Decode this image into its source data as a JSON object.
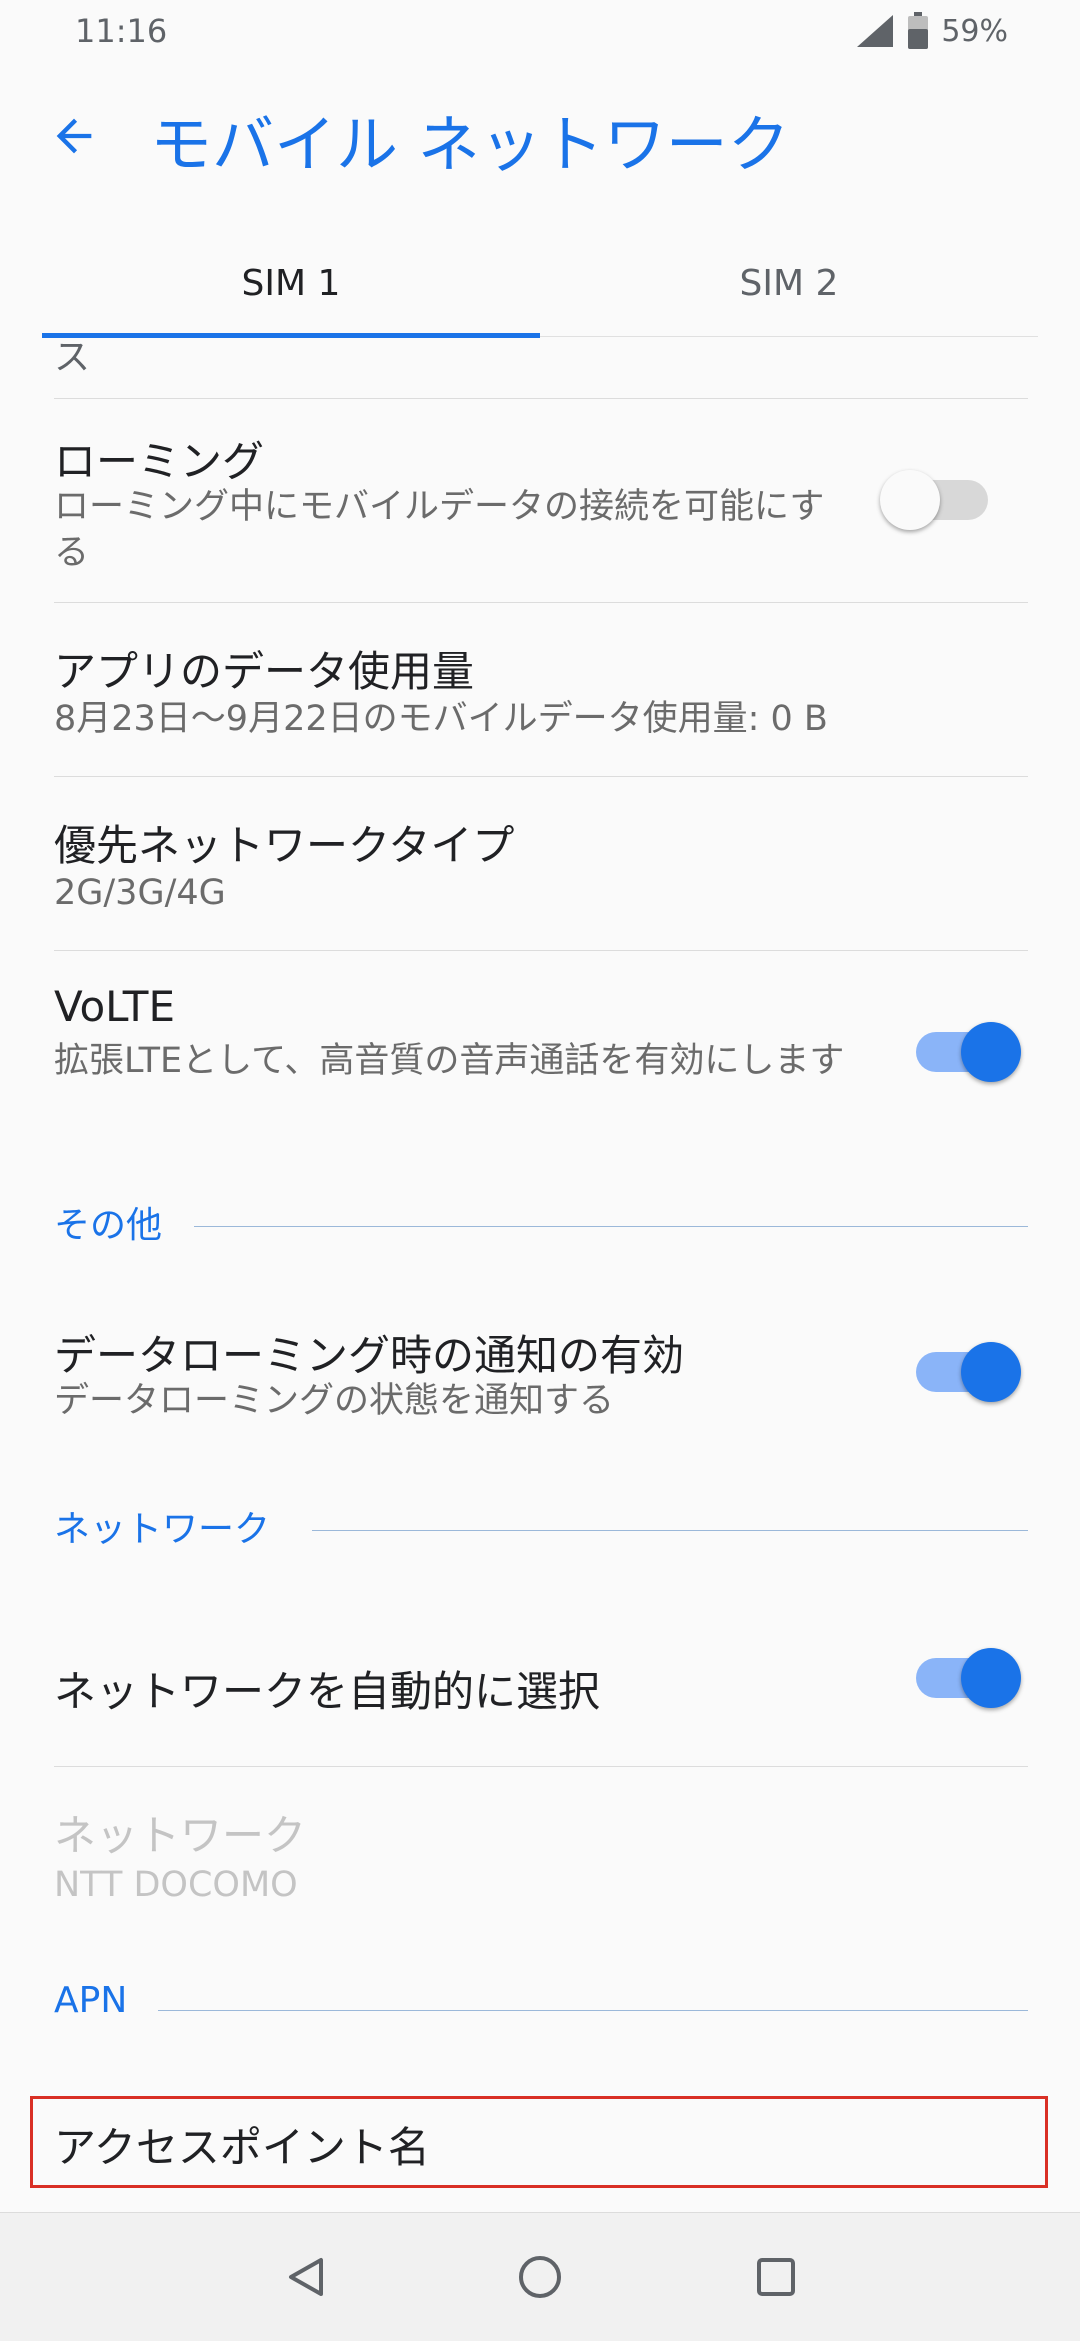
{
  "status_bar": {
    "time": "11:16",
    "battery": "59%"
  },
  "header": {
    "title": "モバイル ネットワーク",
    "back_icon": "arrow-back-icon"
  },
  "tabs": [
    {
      "label": "SIM 1",
      "selected": true
    },
    {
      "label": "SIM 2",
      "selected": false
    }
  ],
  "partial_item": {
    "text": "ス"
  },
  "items": {
    "roaming": {
      "title": "ローミング",
      "subtitle": "ローミング中にモバイルデータの接続を可能にする",
      "enabled": false
    },
    "app_data": {
      "title": "アプリのデータ使用量",
      "subtitle": "8月23日〜9月22日のモバイルデータ使用量: 0 B"
    },
    "preferred_network": {
      "title": "優先ネットワークタイプ",
      "subtitle": "2G/3G/4G"
    },
    "volte": {
      "title": "VoLTE",
      "subtitle": "拡張LTEとして、高音質の音声通話を有効にします",
      "enabled": true
    },
    "roaming_notification": {
      "title": "データローミング時の通知の有効",
      "subtitle": "データローミングの状態を通知する",
      "enabled": true
    },
    "auto_network": {
      "title": "ネットワークを自動的に選択",
      "enabled": true
    },
    "network": {
      "title": "ネットワーク",
      "subtitle": "NTT DOCOMO"
    },
    "access_point": {
      "title": "アクセスポイント名"
    }
  },
  "sections": {
    "other": "その他",
    "network": "ネットワーク",
    "apn": "APN"
  },
  "colors": {
    "accent": "#1a73e8",
    "highlight": "#d93025"
  },
  "nav_bar": {
    "back": "back-triangle-icon",
    "home": "home-circle-icon",
    "recents": "recents-square-icon"
  }
}
